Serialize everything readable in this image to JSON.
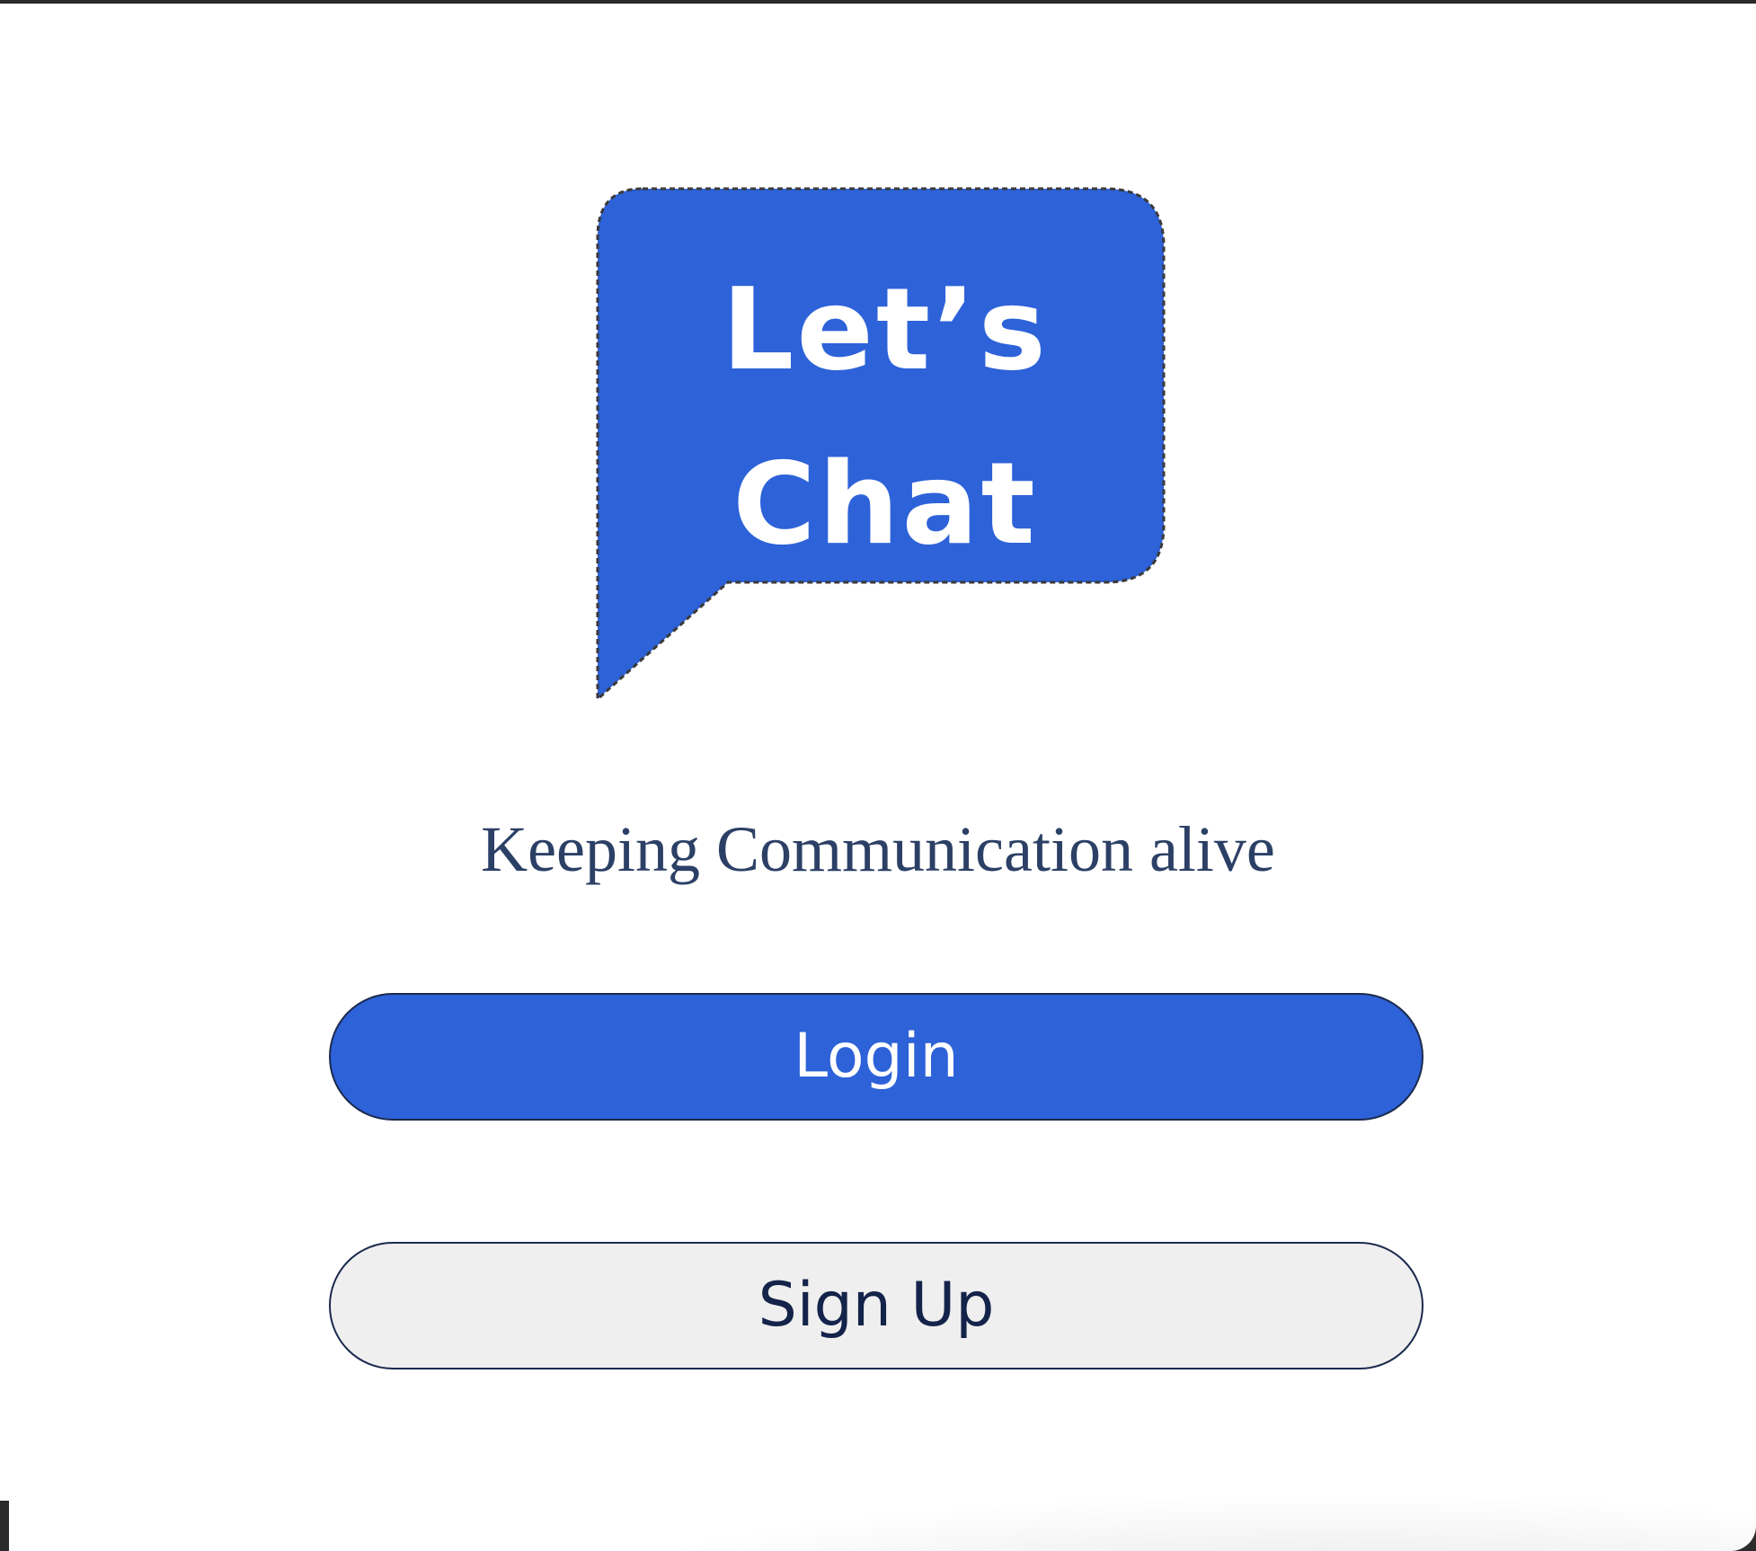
{
  "logo": {
    "line1": "Let’s",
    "line2": "Chat"
  },
  "tagline": "Keeping Communication alive",
  "buttons": {
    "login": "Login",
    "signup": "Sign Up"
  },
  "colors": {
    "brand_blue": "#2d62d8",
    "tagline": "#2c4066",
    "signup_bg": "#efefef",
    "signup_text": "#14234a",
    "border": "#1b2a4e"
  }
}
